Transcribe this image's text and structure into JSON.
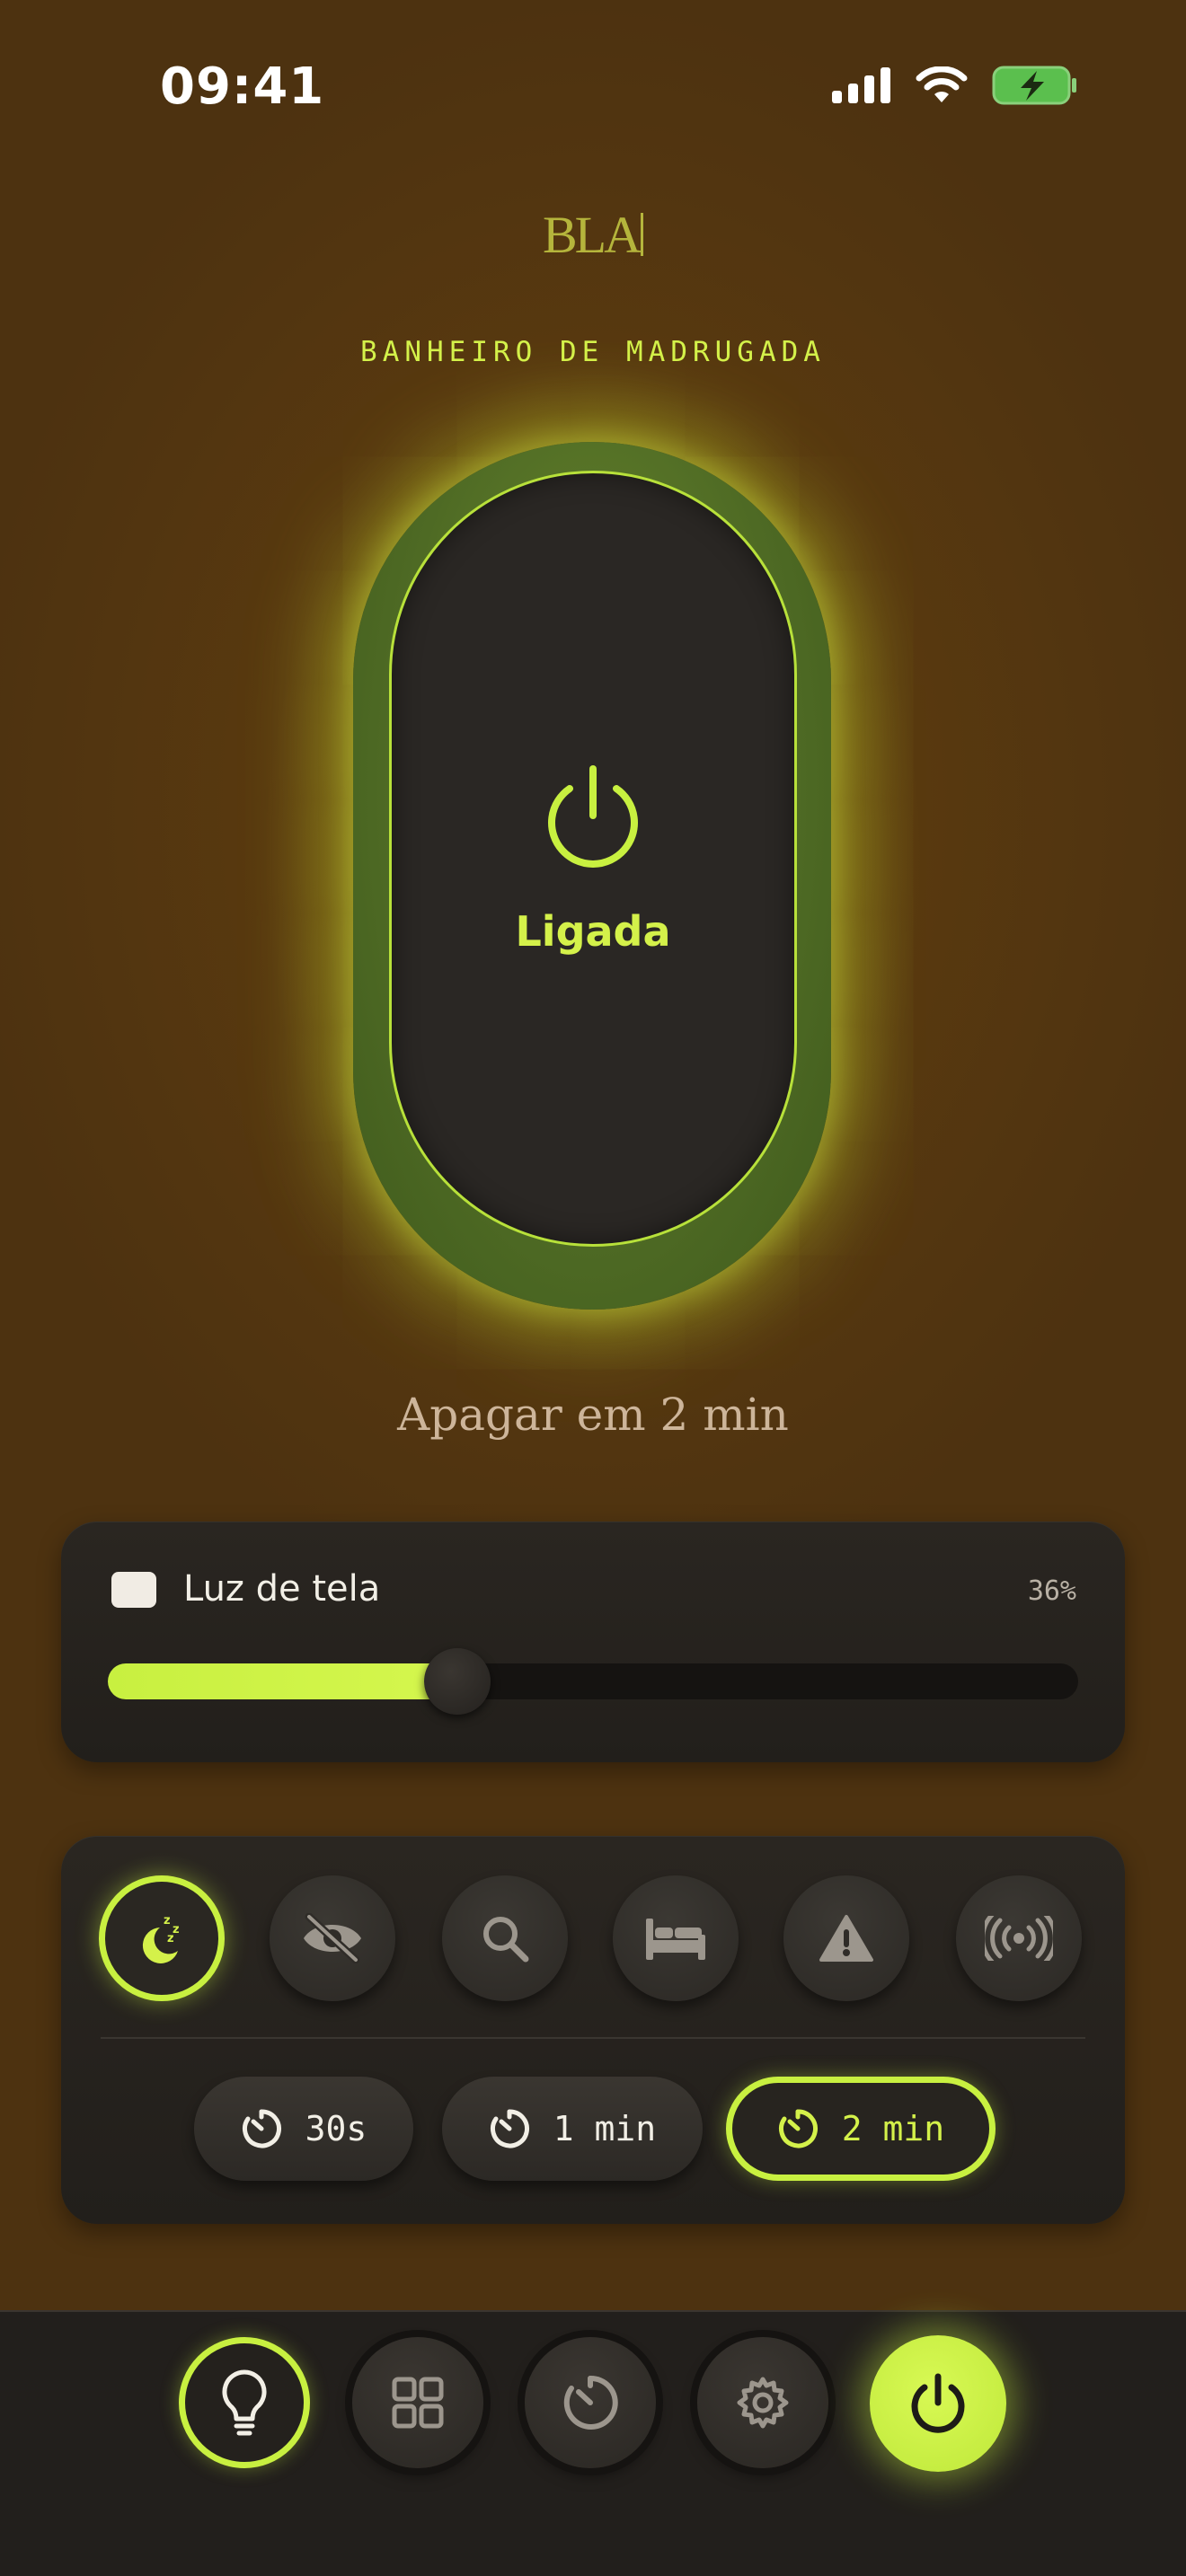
{
  "status_bar": {
    "time": "09:41"
  },
  "brand": {
    "logo_text": "BLA"
  },
  "scene": {
    "title": "BANHEIRO DE MADRUGADA"
  },
  "toggle": {
    "state_label": "Ligada"
  },
  "countdown": {
    "text": "Apagar em 2 min"
  },
  "screen_light": {
    "label": "Luz de tela",
    "percent_text": "36%",
    "value": 0.36,
    "checked": false
  },
  "modes": [
    {
      "icon": "sleep-moon-icon",
      "active": true
    },
    {
      "icon": "eye-off-icon",
      "active": false
    },
    {
      "icon": "search-icon",
      "active": false
    },
    {
      "icon": "bed-icon",
      "active": false
    },
    {
      "icon": "warning-icon",
      "active": false
    },
    {
      "icon": "broadcast-icon",
      "active": false
    }
  ],
  "timers": [
    {
      "label": "30s",
      "active": false
    },
    {
      "label": "1 min",
      "active": false
    },
    {
      "label": "2 min",
      "active": true
    }
  ],
  "nav": [
    {
      "icon": "lightbulb-icon",
      "active": true
    },
    {
      "icon": "grid-icon",
      "active": false
    },
    {
      "icon": "timer-icon",
      "active": false
    },
    {
      "icon": "gear-icon",
      "active": false
    },
    {
      "icon": "power-icon",
      "active": false
    }
  ],
  "colors": {
    "accent": "#c8f040",
    "background": "#5a3a0f",
    "card": "#24211d"
  }
}
